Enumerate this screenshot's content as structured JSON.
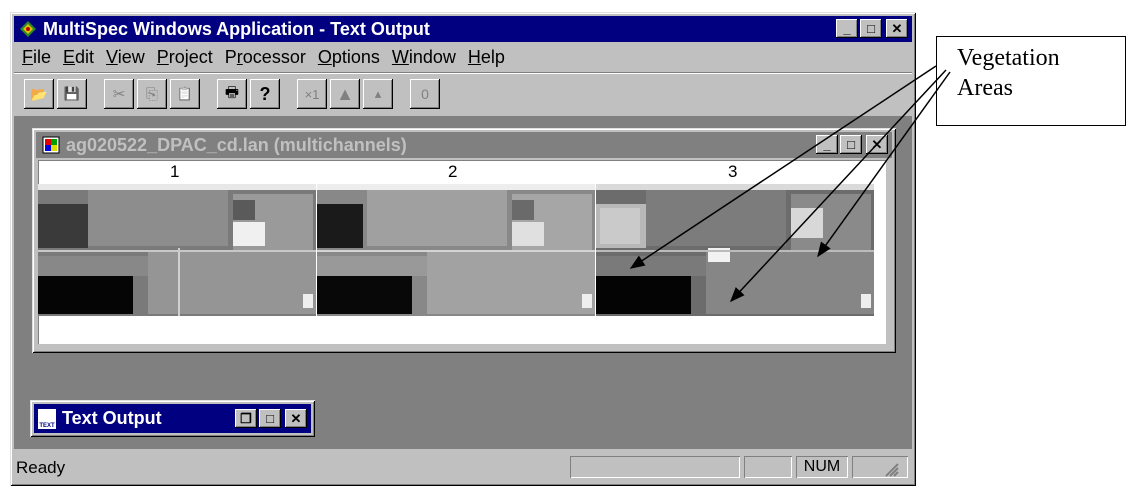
{
  "window": {
    "title": "MultiSpec Windows Application - Text Output",
    "controls": [
      "_",
      "□",
      "✕"
    ]
  },
  "menu": {
    "items": [
      {
        "key": "F",
        "rest": "ile"
      },
      {
        "key": "E",
        "rest": "dit"
      },
      {
        "key": "V",
        "rest": "iew"
      },
      {
        "key": "P",
        "rest": "roject"
      },
      {
        "pre": "P",
        "key": "r",
        "rest": "ocessor"
      },
      {
        "key": "O",
        "rest": "ptions"
      },
      {
        "key": "W",
        "rest": "indow"
      },
      {
        "key": "H",
        "rest": "elp"
      }
    ]
  },
  "toolbar": {
    "open_icon": "📂",
    "save_icon": "💾",
    "cut_icon": "✂",
    "copy_icon": "⎘",
    "paste_icon": "📋",
    "print_icon": "🖶",
    "help_icon": "?",
    "zoom_x1": "×1",
    "zoom_in_icon": "▲",
    "zoom_out_icon": "▴",
    "overlay_icon": "0"
  },
  "image_window": {
    "title": "ag020522_DPAC_cd.lan (multichannels)",
    "channels": [
      "1",
      "2",
      "3"
    ]
  },
  "minimized_window": {
    "title": "Text Output"
  },
  "status": {
    "text": "Ready",
    "num": "NUM"
  },
  "callout": {
    "line1": "Vegetation",
    "line2": "Areas"
  },
  "colors": {
    "title_active": "#000080",
    "title_inactive": "#808080",
    "face": "#c0c0c0",
    "mdi_bg": "#808080"
  }
}
